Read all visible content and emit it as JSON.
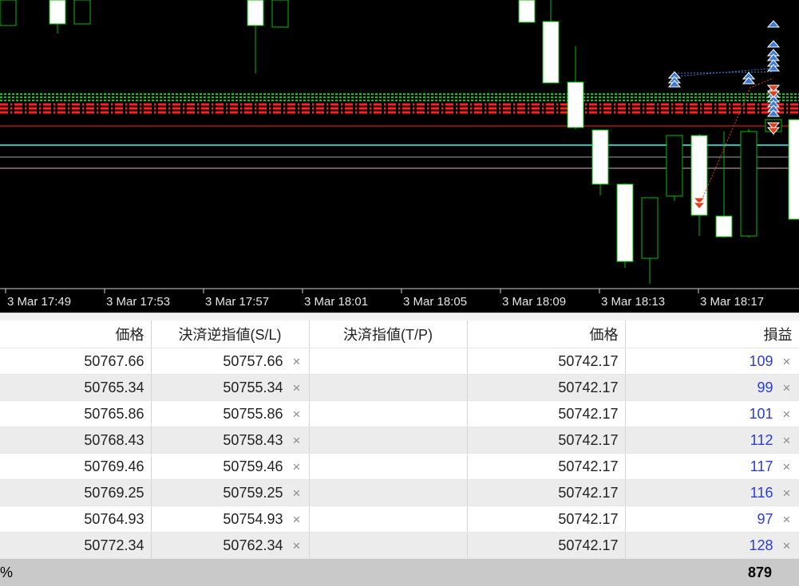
{
  "chart": {
    "time_labels": [
      "3 Mar 17:49",
      "3 Mar 17:53",
      "3 Mar 17:57",
      "3 Mar 18:01",
      "3 Mar 18:05",
      "3 Mar 18:09",
      "3 Mar 18:13",
      "3 Mar 18:17"
    ],
    "colors": {
      "background": "#000000",
      "up_candle": "#00c000",
      "down_candle": "#ffffff",
      "level_green": "#00d000",
      "level_red": "#ff2020",
      "level_cyan": "#20c0c0",
      "level_gray": "#a0a0a0",
      "buy_arrow": "#3a7ad8",
      "sell_arrow": "#e04020"
    }
  },
  "table": {
    "headers": {
      "price": "価格",
      "sl": "決済逆指値(S/L)",
      "tp": "決済指値(T/P)",
      "current_price": "価格",
      "profit": "損益"
    },
    "close_symbol": "×",
    "rows": [
      {
        "price": "50767.66",
        "sl": "50757.66",
        "tp": "",
        "current": "50742.17",
        "profit": "109"
      },
      {
        "price": "50765.34",
        "sl": "50755.34",
        "tp": "",
        "current": "50742.17",
        "profit": "99"
      },
      {
        "price": "50765.86",
        "sl": "50755.86",
        "tp": "",
        "current": "50742.17",
        "profit": "101"
      },
      {
        "price": "50768.43",
        "sl": "50758.43",
        "tp": "",
        "current": "50742.17",
        "profit": "112"
      },
      {
        "price": "50769.46",
        "sl": "50759.46",
        "tp": "",
        "current": "50742.17",
        "profit": "117"
      },
      {
        "price": "50769.25",
        "sl": "50759.25",
        "tp": "",
        "current": "50742.17",
        "profit": "116"
      },
      {
        "price": "50764.93",
        "sl": "50754.93",
        "tp": "",
        "current": "50742.17",
        "profit": "97"
      },
      {
        "price": "50772.34",
        "sl": "50762.34",
        "tp": "",
        "current": "50742.17",
        "profit": "128"
      }
    ]
  },
  "footer": {
    "percent": "%",
    "total": "879"
  }
}
